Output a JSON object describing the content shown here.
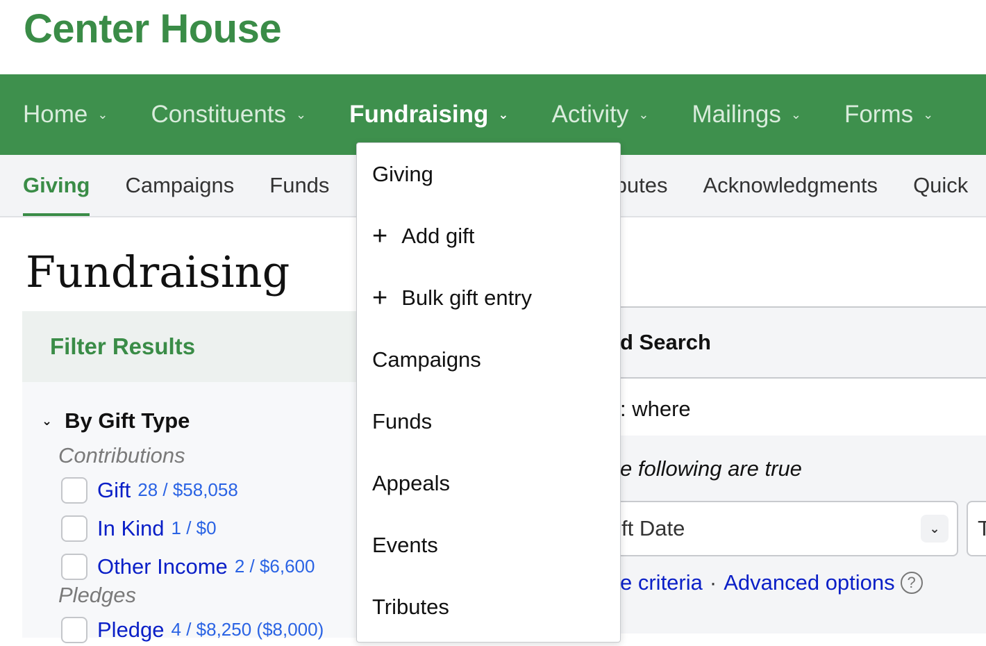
{
  "brand": "Center House",
  "nav": [
    {
      "label": "Home",
      "active": false
    },
    {
      "label": "Constituents",
      "active": false
    },
    {
      "label": "Fundraising",
      "active": true
    },
    {
      "label": "Activity",
      "active": false
    },
    {
      "label": "Mailings",
      "active": false
    },
    {
      "label": "Forms",
      "active": false
    }
  ],
  "subnav": [
    "Giving",
    "Campaigns",
    "Funds",
    "Appeals",
    "Events",
    "Tributes",
    "Acknowledgments",
    "Quick"
  ],
  "subnav_visible": {
    "0": "Giving",
    "1": "Campaigns",
    "2": "Funds",
    "5": "ributes",
    "6": "Acknowledgments",
    "7": "Qui"
  },
  "page_title": "Fundraising",
  "filter": {
    "title": "Filter Results",
    "group": "By Gift Type",
    "sections": [
      {
        "label": "Contributions",
        "options": [
          {
            "label": "Gift",
            "count": "28 / $58,058"
          },
          {
            "label": "In Kind",
            "count": "1 / $0"
          },
          {
            "label": "Other Income",
            "count": "2 / $6,600"
          }
        ]
      },
      {
        "label": "Pledges",
        "options": [
          {
            "label": "Pledge",
            "count": "4 / $8,250 ($8,000)"
          }
        ]
      }
    ]
  },
  "search": {
    "title": "d Search",
    "where": ": where",
    "following": "e following are true",
    "field_value": "ft Date",
    "second_field": "T",
    "links": {
      "criteria": "e criteria",
      "sep": "·",
      "advanced": "Advanced options"
    }
  },
  "dropdown": [
    {
      "label": "Giving",
      "icon": null
    },
    {
      "label": "Add gift",
      "icon": "plus-icon"
    },
    {
      "label": "Bulk gift entry",
      "icon": "plus-icon"
    },
    {
      "label": "Campaigns",
      "icon": null
    },
    {
      "label": "Funds",
      "icon": null
    },
    {
      "label": "Appeals",
      "icon": null
    },
    {
      "label": "Events",
      "icon": null
    },
    {
      "label": "Tributes",
      "icon": null
    }
  ],
  "colors": {
    "brand": "#3a8c47",
    "nav_bg": "#3e904d",
    "link": "#0a1fc7"
  }
}
